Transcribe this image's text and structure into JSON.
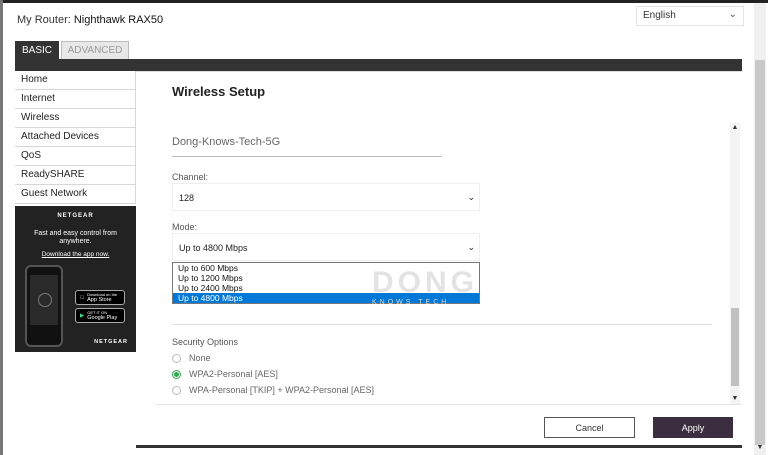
{
  "header": {
    "router_prefix": "My Router:",
    "router_name": "Nighthawk RAX50",
    "language": "English"
  },
  "tabs": [
    {
      "label": "BASIC",
      "active": true
    },
    {
      "label": "ADVANCED",
      "active": false
    }
  ],
  "sidebar": {
    "items": [
      {
        "label": "Home"
      },
      {
        "label": "Internet"
      },
      {
        "label": "Wireless"
      },
      {
        "label": "Attached Devices"
      },
      {
        "label": "QoS"
      },
      {
        "label": "ReadySHARE"
      },
      {
        "label": "Guest Network"
      }
    ],
    "ad": {
      "brand": "NETGEAR",
      "tagline": "Fast and easy control from anywhere.",
      "link": "Download the app now.",
      "app_store_small": "Download on the",
      "app_store": "App Store",
      "google_play_small": "GET IT ON",
      "google_play": "Google Play",
      "footer_brand": "NETGEAR"
    }
  },
  "main": {
    "title": "Wireless Setup",
    "ssid": "Dong-Knows-Tech-5G",
    "channel": {
      "label": "Channel:",
      "value": "128"
    },
    "mode": {
      "label": "Mode:",
      "value": "Up to 4800 Mbps",
      "options": [
        "Up to 600 Mbps",
        "Up to 1200 Mbps",
        "Up to 2400 Mbps",
        "Up to 4800 Mbps"
      ],
      "selected_index": 3
    },
    "security": {
      "label": "Security Options",
      "options": [
        {
          "label": "None",
          "checked": false
        },
        {
          "label": "WPA2-Personal [AES]",
          "checked": true
        },
        {
          "label": "WPA-Personal [TKIP] + WPA2-Personal [AES]",
          "checked": false
        }
      ]
    }
  },
  "watermark": {
    "main": "DONG",
    "sub": "KNOWS TECH"
  },
  "buttons": {
    "cancel": "Cancel",
    "apply": "Apply"
  },
  "colors": {
    "accent_check": "#2fa84f",
    "apply_bg": "#3b2e41",
    "selected_option": "#0078d7",
    "tab_dark": "#333333"
  }
}
